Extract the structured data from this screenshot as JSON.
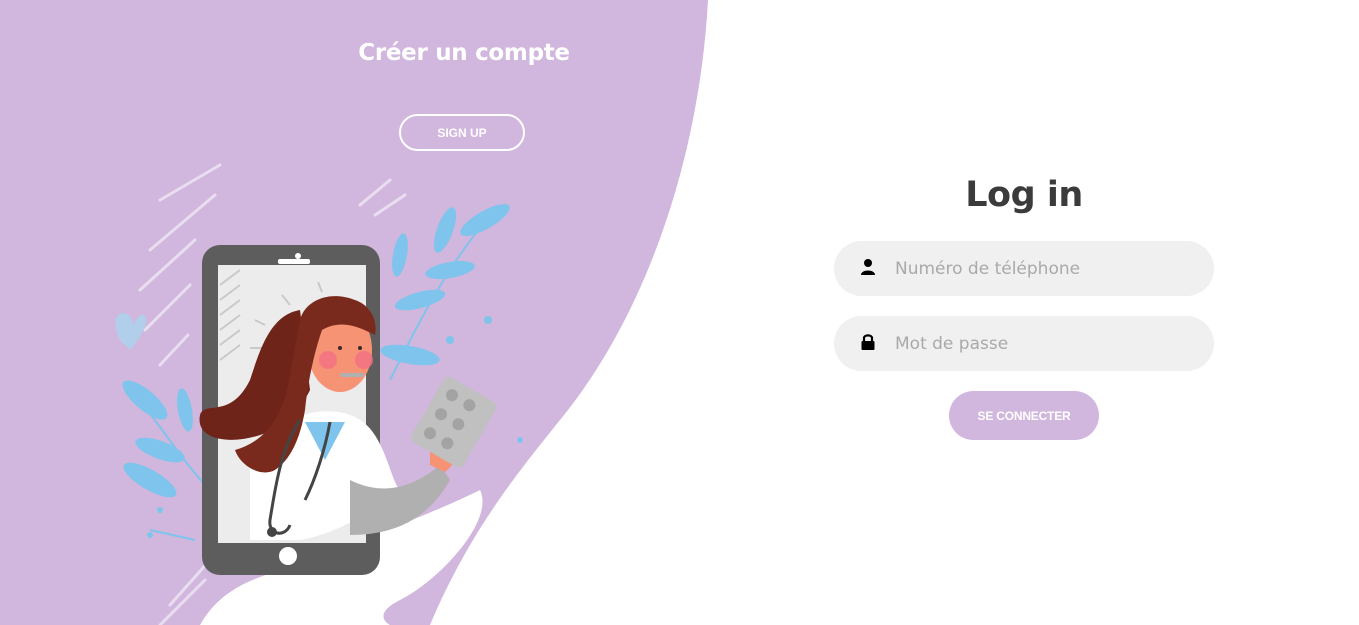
{
  "colors": {
    "accent": "#d1b6de",
    "panel_text": "#ffffff",
    "title_text": "#3b3b3b",
    "input_bg": "#f0f0f0",
    "placeholder": "#a9a9a9"
  },
  "signup_panel": {
    "title": "Créer un compte",
    "signup_button": "SIGN UP"
  },
  "login": {
    "title": "Log in",
    "phone_field": {
      "icon": "user-icon",
      "placeholder": "Numéro de téléphone",
      "value": ""
    },
    "password_field": {
      "icon": "lock-icon",
      "placeholder": "Mot de passe",
      "value": ""
    },
    "submit_button": "SE CONNECTER"
  }
}
